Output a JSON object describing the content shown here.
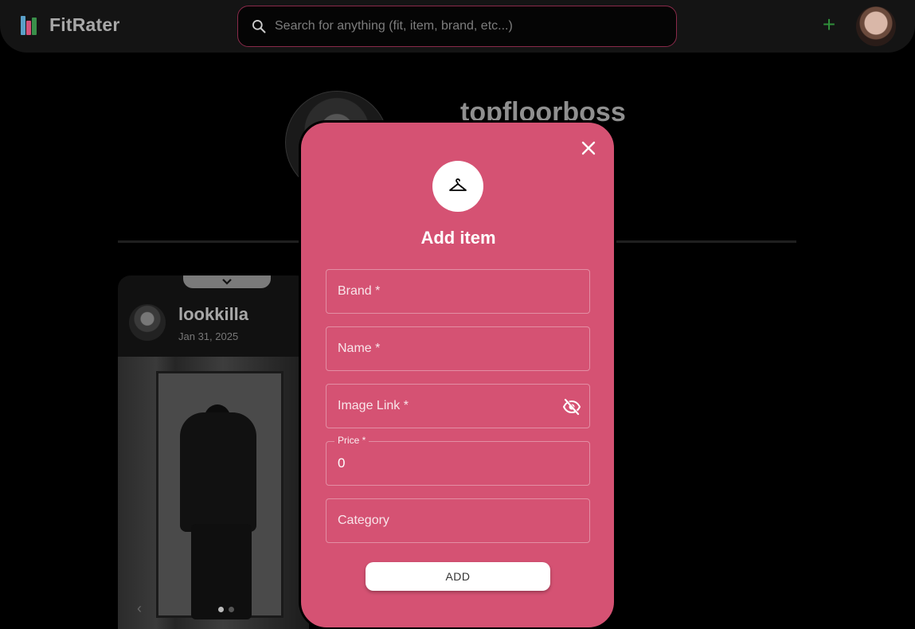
{
  "header": {
    "app_name": "FitRater",
    "search_placeholder": "Search for anything (fit, item, brand, etc...)",
    "add_label": "+"
  },
  "profile": {
    "username": "topfloorboss"
  },
  "post": {
    "username": "lookkilla",
    "date": "Jan 31, 2025"
  },
  "modal": {
    "title": "Add item",
    "fields": {
      "brand_placeholder": "Brand *",
      "name_placeholder": "Name *",
      "image_link_placeholder": "Image Link *",
      "price_label": "Price *",
      "price_value": "0",
      "category_placeholder": "Category"
    },
    "submit_label": "ADD"
  },
  "colors": {
    "modal_bg": "#d55273",
    "search_border": "#8a2a4a",
    "add_icon": "#2f8f3a"
  },
  "icons": [
    "fitrater-logo-icon",
    "search-icon",
    "plus-icon",
    "close-icon",
    "hanger-icon",
    "visibility-off-icon",
    "chevron-down-icon"
  ]
}
